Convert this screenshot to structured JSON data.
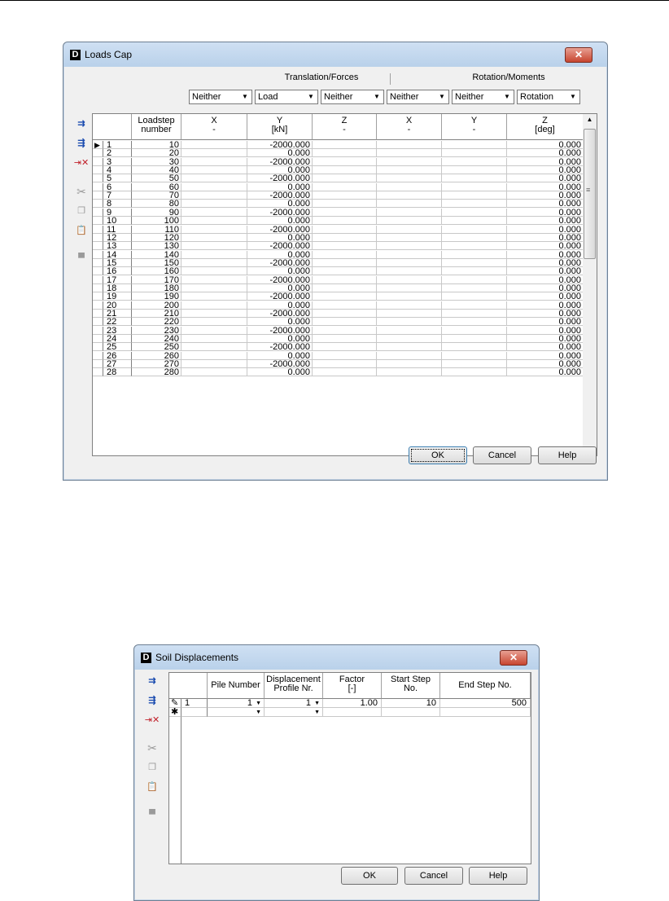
{
  "loads_cap": {
    "title": "Loads Cap",
    "close_label": "✕",
    "groups": {
      "translation": "Translation/Forces",
      "rotation": "Rotation/Moments"
    },
    "combos": [
      "Neither",
      "Load",
      "Neither",
      "Neither",
      "Neither",
      "Rotation"
    ],
    "headers": [
      {
        "line1": "Loadstep",
        "line2": "number"
      },
      {
        "line1": "X",
        "line2": "-"
      },
      {
        "line1": "Y",
        "line2": "[kN]"
      },
      {
        "line1": "Z",
        "line2": "-"
      },
      {
        "line1": "X",
        "line2": "-"
      },
      {
        "line1": "Y",
        "line2": "-"
      },
      {
        "line1": "Z",
        "line2": "[deg]"
      }
    ],
    "rows": [
      [
        "1",
        "10",
        "",
        "-2000.000",
        "",
        "",
        "",
        "0.000"
      ],
      [
        "2",
        "20",
        "",
        "0.000",
        "",
        "",
        "",
        "0.000"
      ],
      [
        "3",
        "30",
        "",
        "-2000.000",
        "",
        "",
        "",
        "0.000"
      ],
      [
        "4",
        "40",
        "",
        "0.000",
        "",
        "",
        "",
        "0.000"
      ],
      [
        "5",
        "50",
        "",
        "-2000.000",
        "",
        "",
        "",
        "0.000"
      ],
      [
        "6",
        "60",
        "",
        "0.000",
        "",
        "",
        "",
        "0.000"
      ],
      [
        "7",
        "70",
        "",
        "-2000.000",
        "",
        "",
        "",
        "0.000"
      ],
      [
        "8",
        "80",
        "",
        "0.000",
        "",
        "",
        "",
        "0.000"
      ],
      [
        "9",
        "90",
        "",
        "-2000.000",
        "",
        "",
        "",
        "0.000"
      ],
      [
        "10",
        "100",
        "",
        "0.000",
        "",
        "",
        "",
        "0.000"
      ],
      [
        "11",
        "110",
        "",
        "-2000.000",
        "",
        "",
        "",
        "0.000"
      ],
      [
        "12",
        "120",
        "",
        "0.000",
        "",
        "",
        "",
        "0.000"
      ],
      [
        "13",
        "130",
        "",
        "-2000.000",
        "",
        "",
        "",
        "0.000"
      ],
      [
        "14",
        "140",
        "",
        "0.000",
        "",
        "",
        "",
        "0.000"
      ],
      [
        "15",
        "150",
        "",
        "-2000.000",
        "",
        "",
        "",
        "0.000"
      ],
      [
        "16",
        "160",
        "",
        "0.000",
        "",
        "",
        "",
        "0.000"
      ],
      [
        "17",
        "170",
        "",
        "-2000.000",
        "",
        "",
        "",
        "0.000"
      ],
      [
        "18",
        "180",
        "",
        "0.000",
        "",
        "",
        "",
        "0.000"
      ],
      [
        "19",
        "190",
        "",
        "-2000.000",
        "",
        "",
        "",
        "0.000"
      ],
      [
        "20",
        "200",
        "",
        "0.000",
        "",
        "",
        "",
        "0.000"
      ],
      [
        "21",
        "210",
        "",
        "-2000.000",
        "",
        "",
        "",
        "0.000"
      ],
      [
        "22",
        "220",
        "",
        "0.000",
        "",
        "",
        "",
        "0.000"
      ],
      [
        "23",
        "230",
        "",
        "-2000.000",
        "",
        "",
        "",
        "0.000"
      ],
      [
        "24",
        "240",
        "",
        "0.000",
        "",
        "",
        "",
        "0.000"
      ],
      [
        "25",
        "250",
        "",
        "-2000.000",
        "",
        "",
        "",
        "0.000"
      ],
      [
        "26",
        "260",
        "",
        "0.000",
        "",
        "",
        "",
        "0.000"
      ],
      [
        "27",
        "270",
        "",
        "-2000.000",
        "",
        "",
        "",
        "0.000"
      ],
      [
        "28",
        "280",
        "",
        "0.000",
        "",
        "",
        "",
        "0.000"
      ]
    ],
    "buttons": {
      "ok": "OK",
      "cancel": "Cancel",
      "help": "Help"
    }
  },
  "soil_displacements": {
    "title": "Soil Displacements",
    "close_label": "✕",
    "headers": [
      {
        "line1": "Pile Number",
        "line2": ""
      },
      {
        "line1": "Displacement",
        "line2": "Profile Nr."
      },
      {
        "line1": "Factor",
        "line2": "[-]"
      },
      {
        "line1": "Start Step",
        "line2": "No."
      },
      {
        "line1": "End Step No.",
        "line2": ""
      }
    ],
    "rows": [
      {
        "marker": "✎",
        "num": "1",
        "pile": "1",
        "profile": "1",
        "factor": "1.00",
        "start": "10",
        "end": "500"
      },
      {
        "marker": "✱",
        "num": "",
        "pile": "",
        "profile": "",
        "factor": "",
        "start": "",
        "end": ""
      }
    ],
    "buttons": {
      "ok": "OK",
      "cancel": "Cancel",
      "help": "Help"
    }
  }
}
